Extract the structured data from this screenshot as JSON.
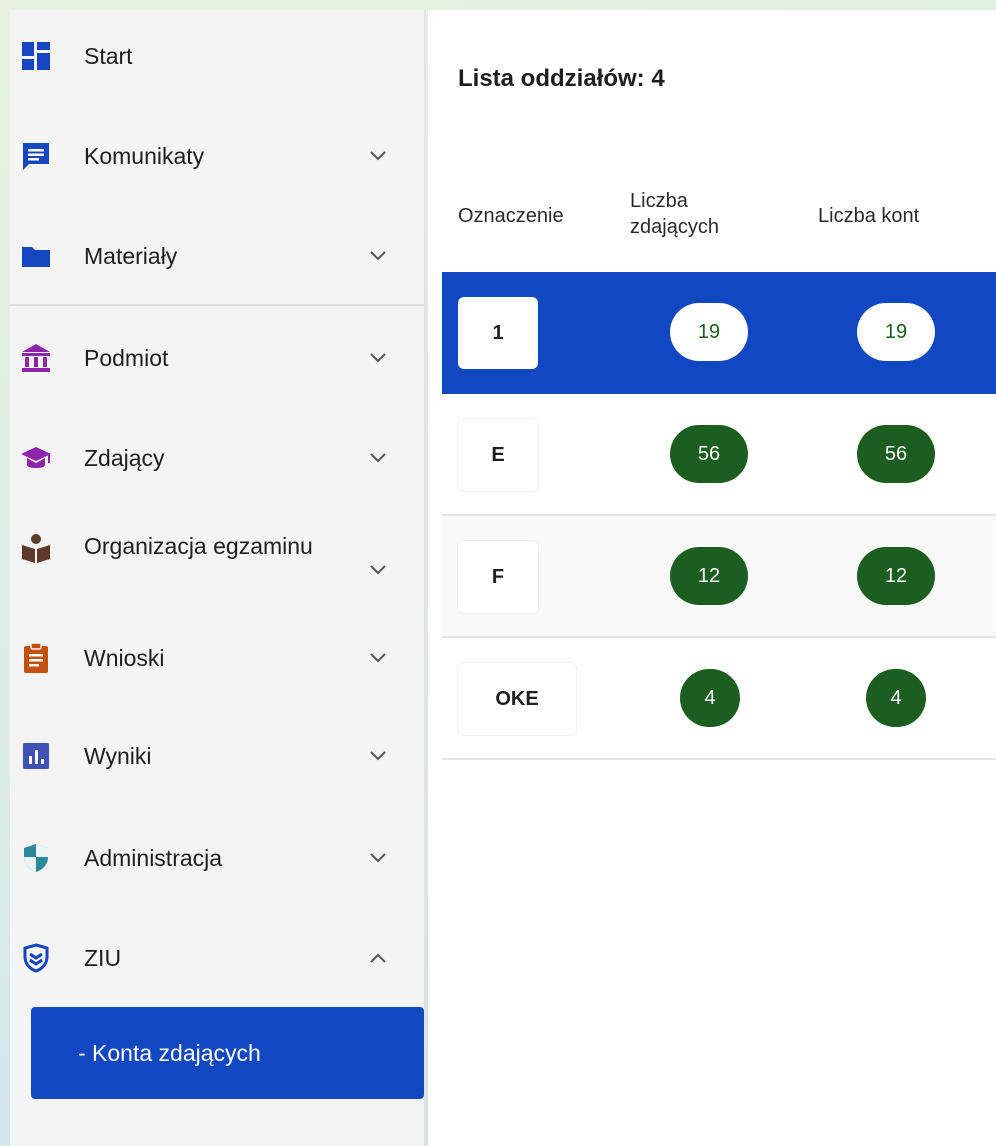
{
  "sidebar": {
    "items": [
      {
        "label": "Start",
        "icon": "dashboard-icon"
      },
      {
        "label": "Komunikaty",
        "icon": "message-icon"
      },
      {
        "label": "Materiały",
        "icon": "folder-icon"
      },
      {
        "label": "Podmiot",
        "icon": "institution-icon"
      },
      {
        "label": "Zdający",
        "icon": "graduation-cap-icon"
      },
      {
        "label": "Organizacja egzaminu",
        "icon": "reader-icon"
      },
      {
        "label": "Wnioski",
        "icon": "clipboard-icon"
      },
      {
        "label": "Wyniki",
        "icon": "bar-chart-icon"
      },
      {
        "label": "Administracja",
        "icon": "shield-icon"
      },
      {
        "label": "ZIU",
        "icon": "verified-shield-icon"
      }
    ],
    "sub_item": "- Konta zdających"
  },
  "main": {
    "title": "Lista oddziałów: 4",
    "columns": {
      "label": "Oznaczenie",
      "students": "Liczba zdających",
      "accounts": "Liczba kont"
    },
    "rows": [
      {
        "label": "1",
        "students": "19",
        "accounts": "19"
      },
      {
        "label": "E",
        "students": "56",
        "accounts": "56"
      },
      {
        "label": "F",
        "students": "12",
        "accounts": "12"
      },
      {
        "label": "OKE",
        "students": "4",
        "accounts": "4"
      }
    ]
  },
  "colors": {
    "accent": "#1148c2",
    "badge_green": "#1b5e20",
    "icon_blue": "#1546c0",
    "icon_purple": "#8e24aa",
    "icon_brown": "#5d3a2a",
    "icon_orange": "#c4510f",
    "icon_indigo": "#3f51b5",
    "icon_teal": "#2a8a9c"
  }
}
